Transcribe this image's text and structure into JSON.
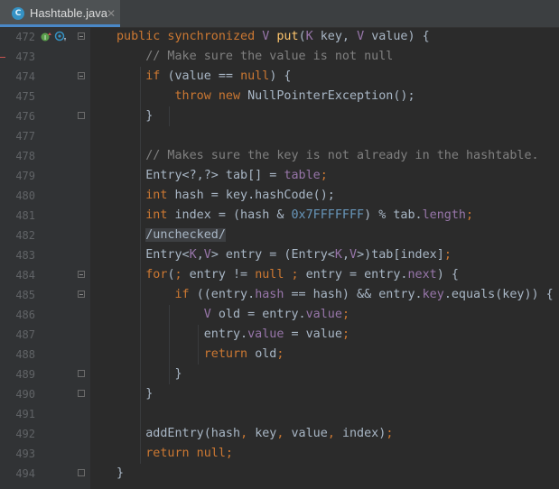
{
  "tab": {
    "title": "Hashtable.java",
    "close_glyph": "✕",
    "file_icon_letter": "C",
    "file_icon": "java-class-icon"
  },
  "gutter_icons": {
    "override": "override-up-icon",
    "implements": "implemented-down-icon"
  },
  "lines": [
    {
      "n": "472",
      "tokens": [
        [
          "kw",
          "public synchronized "
        ],
        [
          "tp",
          "V "
        ],
        [
          "fn",
          "put"
        ],
        [
          "",
          "("
        ],
        [
          "tp",
          "K "
        ],
        [
          "",
          "key, "
        ],
        [
          "tp",
          "V "
        ],
        [
          "",
          "value) {"
        ]
      ]
    },
    {
      "n": "473",
      "tokens": [
        [
          "cm",
          "    // Make sure the value is not null"
        ]
      ]
    },
    {
      "n": "474",
      "tokens": [
        [
          "kw",
          "    if "
        ],
        [
          "",
          "(value == "
        ],
        [
          "kw",
          "null"
        ],
        [
          "",
          ") {"
        ]
      ]
    },
    {
      "n": "475",
      "tokens": [
        [
          "kw",
          "        throw new "
        ],
        [
          "",
          "NullPointerException();"
        ]
      ]
    },
    {
      "n": "476",
      "tokens": [
        [
          "",
          "    }"
        ]
      ]
    },
    {
      "n": "477",
      "tokens": []
    },
    {
      "n": "478",
      "tokens": [
        [
          "cm",
          "    // Makes sure the key is not already in the hashtable."
        ]
      ]
    },
    {
      "n": "479",
      "tokens": [
        [
          "",
          "    Entry<?,?> tab[] = "
        ],
        [
          "fld",
          "table"
        ],
        [
          "kw",
          ";"
        ]
      ]
    },
    {
      "n": "480",
      "tokens": [
        [
          "kw",
          "    int "
        ],
        [
          "",
          "hash = key.hashCode();"
        ]
      ]
    },
    {
      "n": "481",
      "tokens": [
        [
          "kw",
          "    int "
        ],
        [
          "",
          "index = (hash & "
        ],
        [
          "num",
          "0x7FFFFFFF"
        ],
        [
          "",
          ") % tab."
        ],
        [
          "fld",
          "length"
        ],
        [
          "kw",
          ";"
        ]
      ]
    },
    {
      "n": "482",
      "tokens": [
        [
          "",
          "    "
        ],
        [
          "noinspect",
          "/unchecked/"
        ]
      ]
    },
    {
      "n": "483",
      "tokens": [
        [
          "",
          "    Entry<"
        ],
        [
          "tp",
          "K"
        ],
        [
          "",
          ","
        ],
        [
          "tp",
          "V"
        ],
        [
          "",
          "> entry = (Entry<"
        ],
        [
          "tp",
          "K"
        ],
        [
          "",
          ","
        ],
        [
          "tp",
          "V"
        ],
        [
          "",
          ">)tab[index]"
        ],
        [
          "kw",
          ";"
        ]
      ]
    },
    {
      "n": "484",
      "tokens": [
        [
          "kw",
          "    for"
        ],
        [
          "",
          "("
        ],
        [
          "kw",
          "; "
        ],
        [
          "",
          "entry != "
        ],
        [
          "kw",
          "null ; "
        ],
        [
          "",
          "entry = entry."
        ],
        [
          "fld",
          "next"
        ],
        [
          "",
          ") {"
        ]
      ]
    },
    {
      "n": "485",
      "tokens": [
        [
          "kw",
          "        if "
        ],
        [
          "",
          "((entry."
        ],
        [
          "fld",
          "hash"
        ],
        [
          "",
          " == hash) && entry."
        ],
        [
          "fld",
          "key"
        ],
        [
          "",
          ".equals(key)) {"
        ]
      ]
    },
    {
      "n": "486",
      "tokens": [
        [
          "",
          "            "
        ],
        [
          "tp",
          "V "
        ],
        [
          "",
          "old = entry."
        ],
        [
          "fld",
          "value"
        ],
        [
          "kw",
          ";"
        ]
      ]
    },
    {
      "n": "487",
      "tokens": [
        [
          "",
          "            entry."
        ],
        [
          "fld",
          "value"
        ],
        [
          "",
          " = value"
        ],
        [
          "kw",
          ";"
        ]
      ]
    },
    {
      "n": "488",
      "tokens": [
        [
          "kw",
          "            return "
        ],
        [
          "",
          "old"
        ],
        [
          "kw",
          ";"
        ]
      ]
    },
    {
      "n": "489",
      "tokens": [
        [
          "",
          "        }"
        ]
      ]
    },
    {
      "n": "490",
      "tokens": [
        [
          "",
          "    }"
        ]
      ]
    },
    {
      "n": "491",
      "tokens": []
    },
    {
      "n": "492",
      "tokens": [
        [
          "",
          "    addEntry(hash"
        ],
        [
          "kw",
          ", "
        ],
        [
          "",
          "key"
        ],
        [
          "kw",
          ", "
        ],
        [
          "",
          "value"
        ],
        [
          "kw",
          ", "
        ],
        [
          "",
          "index)"
        ],
        [
          "kw",
          ";"
        ]
      ]
    },
    {
      "n": "493",
      "tokens": [
        [
          "kw",
          "    return null;"
        ]
      ]
    },
    {
      "n": "494",
      "tokens": [
        [
          "",
          "}"
        ]
      ]
    }
  ],
  "folds": [
    "472",
    "474",
    "476",
    "484",
    "485",
    "489",
    "490",
    "494"
  ]
}
